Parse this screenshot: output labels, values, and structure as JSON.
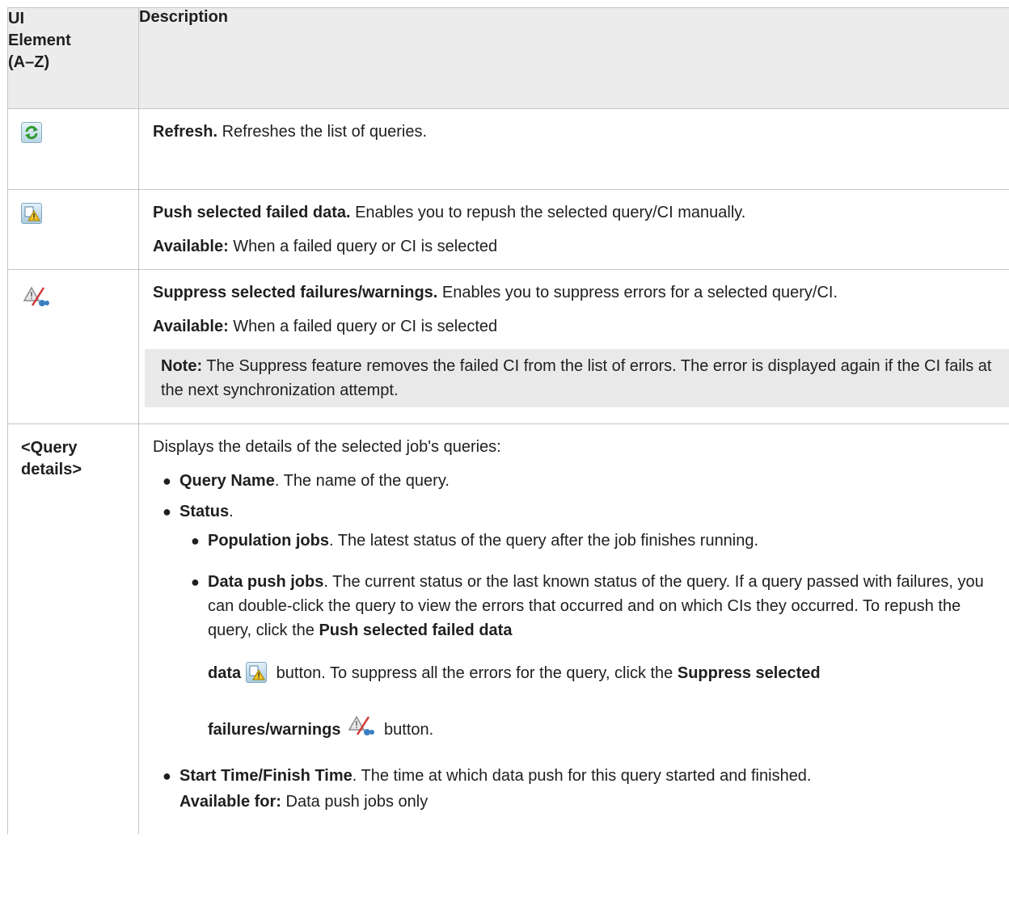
{
  "header": {
    "col1": [
      "UI",
      "Element",
      "(A–Z)"
    ],
    "col2": "Description"
  },
  "rows": [
    {
      "icon": "refresh-icon",
      "title": "Refresh.",
      "text": " Refreshes the list of queries."
    },
    {
      "icon": "push-failed-data-icon",
      "title": "Push selected failed data.",
      "text": " Enables you to repush the selected query/CI manually.",
      "avail_label": "Available:",
      "avail_text": " When a failed query or CI is selected"
    },
    {
      "icon": "suppress-icon",
      "title": "Suppress selected failures/warnings.",
      "text": " Enables you to suppress errors for a selected query/CI.",
      "avail_label": "Available:",
      "avail_text": " When a failed query or CI is selected",
      "note_label": "Note:",
      "note_text": " The Suppress feature removes the failed CI from the list of errors. The error is displayed again if the CI fails at the next synchronization attempt."
    },
    {
      "label": [
        "<Query",
        "details>"
      ],
      "intro": "Displays the details of the selected job's queries:",
      "b1_title": "Query Name",
      "b1_text": ". The name of the query.",
      "b2_title": "Status",
      "b2_text": ".",
      "s1_title": "Population jobs",
      "s1_text": ". The latest status of the query after the job finishes running.",
      "s2_title": "Data push jobs",
      "s2_text_a": ". The current status or the last known status of the query. If a query passed with failures, you can double-click the query to view the errors that occurred and on which CIs they occurred. To repush the query, click the ",
      "s2_push_label": "Push selected failed data",
      "s2_text_b": " button. To suppress all the errors for the query, click the ",
      "s2_suppress_label": "Suppress selected failures/warnings",
      "s2_text_c": " button.",
      "b3_title": "Start Time/Finish Time",
      "b3_text": ". The time at which data push for this query started and finished.",
      "b3_avail_label": "Available for:",
      "b3_avail_text": " Data push jobs only"
    }
  ],
  "colors": {
    "header_bg": "#ececec",
    "note_bg": "#e9e9e9",
    "border": "#c6c6c6"
  }
}
